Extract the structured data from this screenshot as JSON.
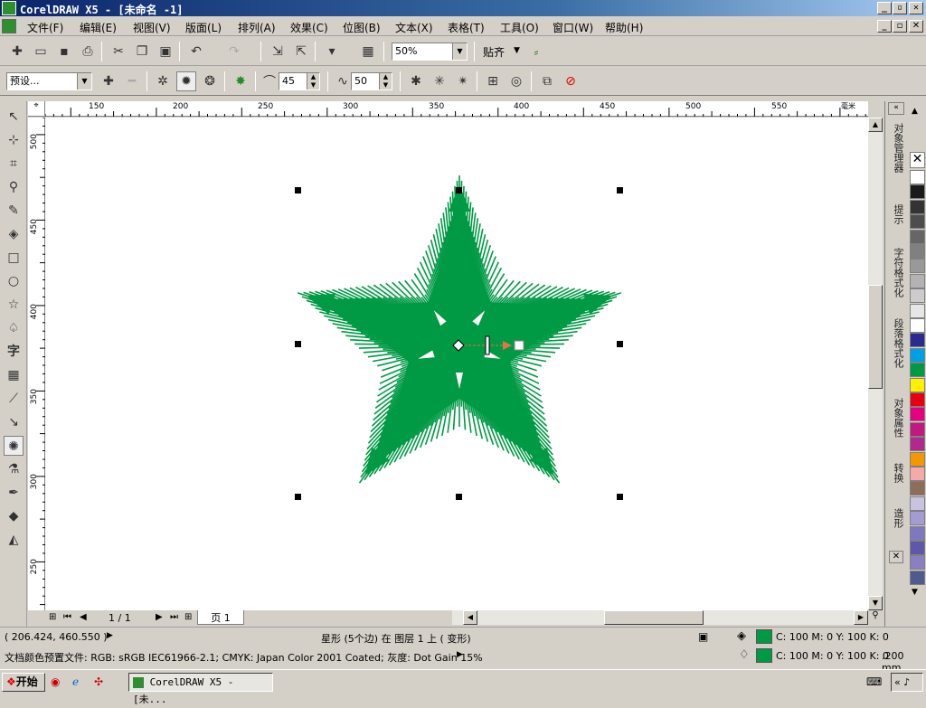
{
  "window": {
    "title": "CorelDRAW X5 - [未命名 -1]",
    "min": "_",
    "max": "▫",
    "close": "✕"
  },
  "menu": [
    {
      "label": "文件(F)"
    },
    {
      "label": "编辑(E)"
    },
    {
      "label": "视图(V)"
    },
    {
      "label": "版面(L)"
    },
    {
      "label": "排列(A)"
    },
    {
      "label": "效果(C)"
    },
    {
      "label": "位图(B)"
    },
    {
      "label": "文本(X)"
    },
    {
      "label": "表格(T)"
    },
    {
      "label": "工具(O)"
    },
    {
      "label": "窗口(W)"
    },
    {
      "label": "帮助(H)"
    }
  ],
  "toolbar": {
    "zoom": "50%",
    "snap_label": "贴齐"
  },
  "propbar": {
    "preset": "预设...",
    "amplitude": "45",
    "frequency": "50"
  },
  "ruler": {
    "h_ticks": [
      "150",
      "200",
      "250",
      "300",
      "350",
      "400",
      "450",
      "500",
      "550"
    ],
    "v_ticks": [
      "500",
      "450",
      "400",
      "350",
      "300",
      "250"
    ],
    "unit": "毫米"
  },
  "page_nav": {
    "counter": "1 / 1",
    "tab": "页 1"
  },
  "dock_tabs": [
    "对象管理器",
    "提示",
    "字符格式化",
    "段落格式化",
    "对象属性",
    "转换",
    "造形"
  ],
  "palette": [
    "#ffffff",
    "#1a1a1a",
    "#333333",
    "#4d4d4d",
    "#666666",
    "#808080",
    "#999999",
    "#b3b3b3",
    "#cccccc",
    "#e6e6e6",
    "#ffffff",
    "#2b2b8f",
    "#00a0e9",
    "#009944",
    "#fff100",
    "#e60012",
    "#e4007f",
    "#c01980",
    "#b0298e",
    "#f39800",
    "#f5a9a9",
    "#8c6e5a",
    "#c9c3e0",
    "#a49bd1",
    "#7f78c0",
    "#5f58a8",
    "#8a7fc0",
    "#505a8c"
  ],
  "status": {
    "coords": "( 206.424, 460.550 )",
    "object_info": "星形 (5个边) 在 图层 1 上 ( 变形)",
    "color_profile": "文档颜色预置文件: RGB: sRGB IEC61966-2.1; CMYK: Japan Color 2001 Coated; 灰度: Dot Gain 15%",
    "fill_cmyk": "C: 100 M: 0 Y: 100 K: 0",
    "outline_cmyk": "C: 100 M: 0 Y: 100 K: 0",
    "outline_width": ".200 mm"
  },
  "taskbar": {
    "start": "开始",
    "task": "CorelDRAW X5 - [未..."
  },
  "colors": {
    "star_fill": "#009a44",
    "titlebar": "#0a246a"
  }
}
